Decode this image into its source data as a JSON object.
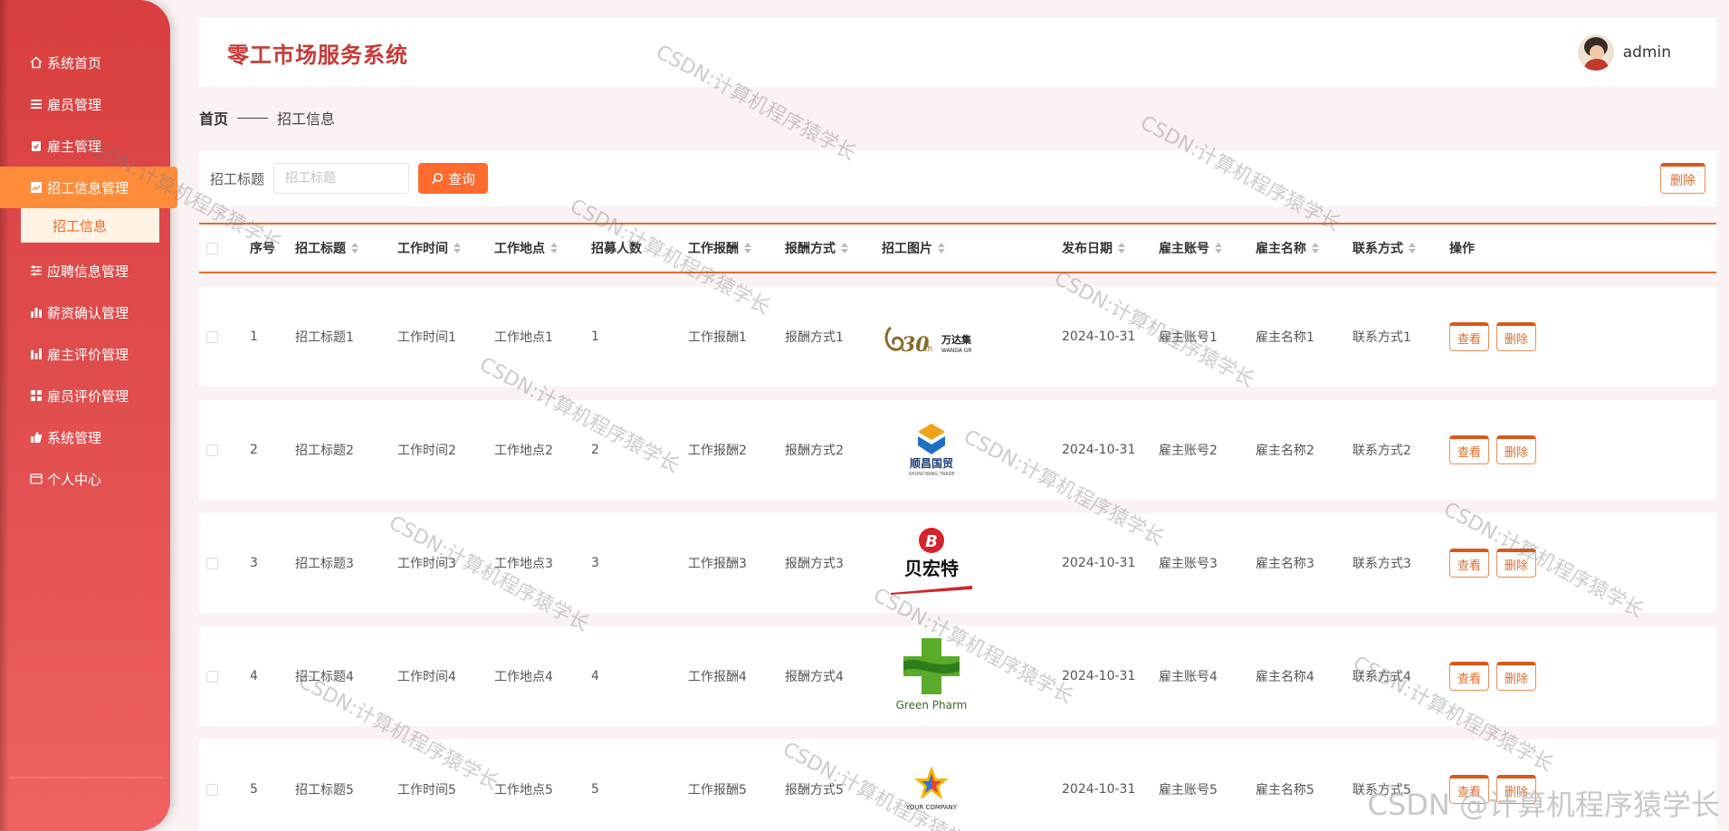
{
  "app": {
    "title": "零工市场服务系统",
    "user": "admin"
  },
  "sidebar": {
    "items": [
      {
        "label": "系统首页",
        "icon": "home-icon"
      },
      {
        "label": "雇员管理",
        "icon": "list-icon"
      },
      {
        "label": "雇主管理",
        "icon": "clipboard-icon"
      },
      {
        "label": "招工信息管理",
        "icon": "chart-icon"
      },
      {
        "label": "应聘信息管理",
        "icon": "sliders-icon"
      },
      {
        "label": "薪资确认管理",
        "icon": "bar-chart-icon"
      },
      {
        "label": "雇主评价管理",
        "icon": "bar-chart-icon"
      },
      {
        "label": "雇员评价管理",
        "icon": "grid-icon"
      },
      {
        "label": "系统管理",
        "icon": "thumb-icon"
      },
      {
        "label": "个人中心",
        "icon": "card-icon"
      }
    ],
    "submenu": "招工信息"
  },
  "breadcrumb": {
    "home": "首页",
    "current": "招工信息"
  },
  "search": {
    "label": "招工标题",
    "placeholder": "招工标题",
    "query_button": "查询",
    "delete_button": "删除"
  },
  "table": {
    "headers": [
      "序号",
      "招工标题",
      "工作时间",
      "工作地点",
      "招募人数",
      "工作报酬",
      "报酬方式",
      "招工图片",
      "发布日期",
      "雇主账号",
      "雇主名称",
      "联系方式",
      "操作"
    ],
    "view_label": "查看",
    "delete_label": "删除",
    "rows": [
      {
        "no": "1",
        "title": "招工标题1",
        "time": "工作时间1",
        "place": "工作地点1",
        "count": "1",
        "pay": "工作报酬1",
        "pay_type": "报酬方式1",
        "image": "wanda-logo",
        "date": "2024-10-31",
        "account": "雇主账号1",
        "name": "雇主名称1",
        "contact": "联系方式1"
      },
      {
        "no": "2",
        "title": "招工标题2",
        "time": "工作时间2",
        "place": "工作地点2",
        "count": "2",
        "pay": "工作报酬2",
        "pay_type": "报酬方式2",
        "image": "shunchang-logo",
        "date": "2024-10-31",
        "account": "雇主账号2",
        "name": "雇主名称2",
        "contact": "联系方式2"
      },
      {
        "no": "3",
        "title": "招工标题3",
        "time": "工作时间3",
        "place": "工作地点3",
        "count": "3",
        "pay": "工作报酬3",
        "pay_type": "报酬方式3",
        "image": "beihongte-logo",
        "date": "2024-10-31",
        "account": "雇主账号3",
        "name": "雇主名称3",
        "contact": "联系方式3"
      },
      {
        "no": "4",
        "title": "招工标题4",
        "time": "工作时间4",
        "place": "工作地点4",
        "count": "4",
        "pay": "工作报酬4",
        "pay_type": "报酬方式4",
        "image": "greenpharm-logo",
        "date": "2024-10-31",
        "account": "雇主账号4",
        "name": "雇主名称4",
        "contact": "联系方式4"
      },
      {
        "no": "5",
        "title": "招工标题5",
        "time": "工作时间5",
        "place": "工作地点5",
        "count": "5",
        "pay": "工作报酬5",
        "pay_type": "报酬方式5",
        "image": "yourcompany-logo",
        "date": "2024-10-31",
        "account": "雇主账号5",
        "name": "雇主名称5",
        "contact": "联系方式5"
      }
    ]
  },
  "logos": {
    "wanda": {
      "big": "30",
      "sub": "th",
      "cn": "万达集",
      "en": "WANDA GR"
    },
    "shunchang": {
      "cn": "顺昌国贸",
      "en": "SHUNCHANG TRADE"
    },
    "beihongte": {
      "cn": "贝宏特"
    },
    "greenpharm": {
      "en": "Green Pharm"
    },
    "yourcompany": {
      "en": "YOUR COMPANY"
    }
  },
  "watermark": {
    "text": "CSDN:计算机程序猿学长",
    "corner": "CSDN @计算机程序猿学长"
  },
  "colors": {
    "sidebar": "#d93f3f",
    "accent": "#ff6a2e",
    "title": "#c63a36",
    "active_menu": "#ff8c3a"
  }
}
